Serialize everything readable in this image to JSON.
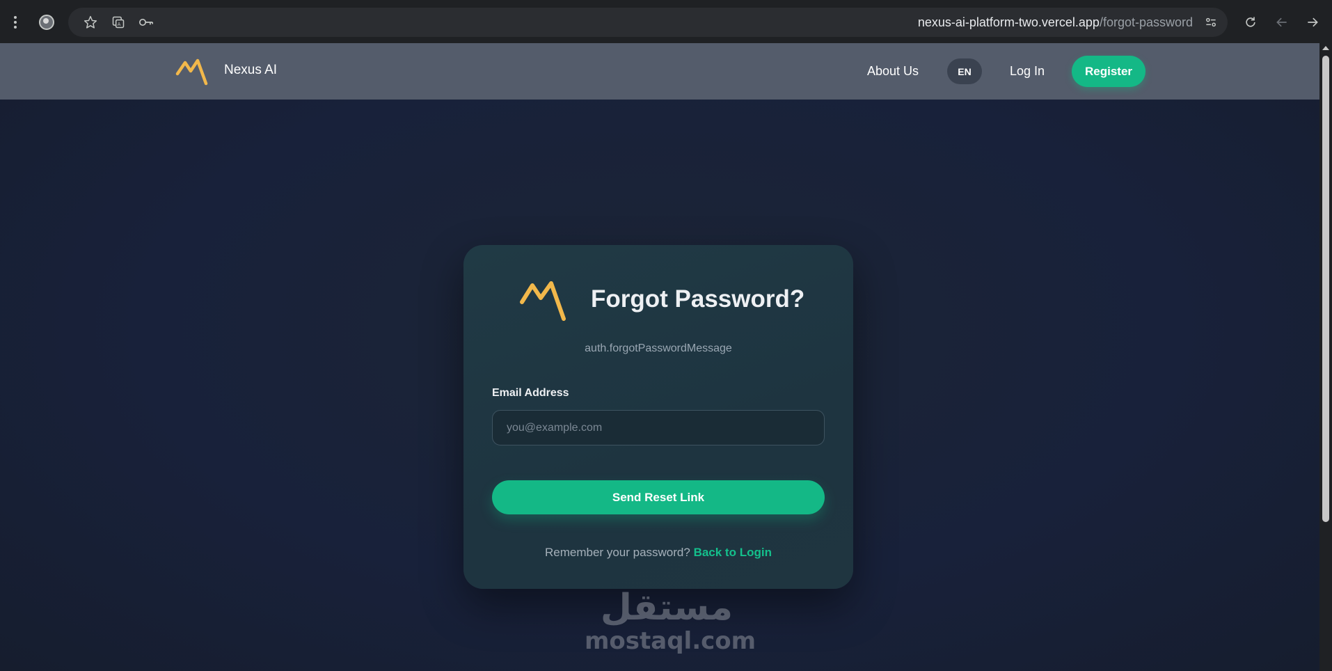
{
  "browser": {
    "url_domain": "nexus-ai-platform-two.vercel.app",
    "url_path": "/forgot-password",
    "icons": [
      "menu-icon",
      "profile-icon",
      "star-icon",
      "translate-icon",
      "key-icon",
      "site-settings-icon",
      "reload-icon",
      "back-icon",
      "forward-icon"
    ]
  },
  "header": {
    "brand_name": "Nexus AI",
    "nav": {
      "about": "About Us",
      "language": "EN",
      "login": "Log In",
      "register": "Register"
    }
  },
  "card": {
    "title": "Forgot Password?",
    "subtitle": "auth.forgotPasswordMessage",
    "email_label": "Email Address",
    "email_placeholder": "you@example.com",
    "email_value": "",
    "submit_label": "Send Reset Link",
    "footer_text": "Remember your password?",
    "footer_link": "Back to Login"
  },
  "watermark": {
    "arabic": "مستقل",
    "latin": "mostaql.com"
  },
  "colors": {
    "accent": "#14b886",
    "logo": "#f2b84b",
    "header_bg": "#545c6b",
    "card_bg": "#1f3540"
  }
}
